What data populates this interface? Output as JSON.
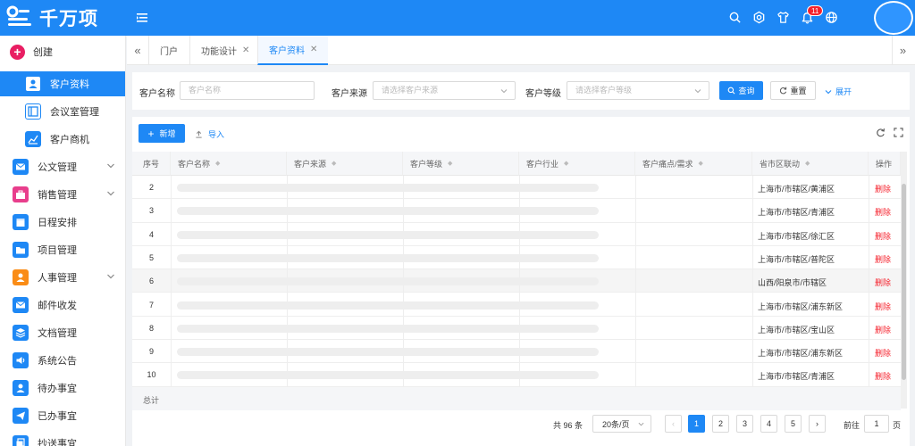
{
  "app": {
    "logo_text": "千万项",
    "notification_count": "11"
  },
  "colors": {
    "primary": "#1e88f5",
    "danger": "#f5222d",
    "create": "#e91e63"
  },
  "sidebar": {
    "create_label": "创建",
    "items": [
      {
        "label": "客户资料",
        "icon": "user-icon",
        "color": "#1e88f5",
        "active": true,
        "sub": true
      },
      {
        "label": "会议室管理",
        "icon": "layout-icon",
        "color": "#1e88f5",
        "sub": true
      },
      {
        "label": "客户商机",
        "icon": "chart-icon",
        "color": "#1e88f5",
        "sub": true
      },
      {
        "label": "公文管理",
        "icon": "mail-icon",
        "color": "#1e88f5",
        "expandable": true
      },
      {
        "label": "销售管理",
        "icon": "briefcase-icon",
        "color": "#e83e8c",
        "expandable": true
      },
      {
        "label": "日程安排",
        "icon": "calendar-icon",
        "color": "#1e88f5"
      },
      {
        "label": "项目管理",
        "icon": "folder-icon",
        "color": "#1e88f5"
      },
      {
        "label": "人事管理",
        "icon": "person-icon",
        "color": "#fa8c16",
        "expandable": true
      },
      {
        "label": "邮件收发",
        "icon": "mail-icon",
        "color": "#1e88f5"
      },
      {
        "label": "文档管理",
        "icon": "layers-icon",
        "color": "#1e88f5"
      },
      {
        "label": "系统公告",
        "icon": "speaker-icon",
        "color": "#1e88f5"
      },
      {
        "label": "待办事宜",
        "icon": "person-icon",
        "color": "#1e88f5"
      },
      {
        "label": "已办事宜",
        "icon": "send-icon",
        "color": "#1e88f5"
      },
      {
        "label": "抄送事宜",
        "icon": "copy-icon",
        "color": "#1e88f5"
      }
    ]
  },
  "tabs": [
    {
      "label": "门户",
      "closable": false
    },
    {
      "label": "功能设计",
      "closable": true
    },
    {
      "label": "客户资料",
      "closable": true,
      "active": true
    }
  ],
  "filters": {
    "name_label": "客户名称",
    "name_placeholder": "客户名称",
    "source_label": "客户来源",
    "source_placeholder": "请选择客户来源",
    "level_label": "客户等级",
    "level_placeholder": "请选择客户等级",
    "query_button": "查询",
    "reset_button": "重置",
    "expand_link": "展开"
  },
  "toolbar": {
    "add_button": "新增",
    "import_button": "导入"
  },
  "table": {
    "columns": [
      "序号",
      "客户名称",
      "客户来源",
      "客户等级",
      "客户行业",
      "客户痛点/需求",
      "省市区联动",
      "操作"
    ],
    "rows": [
      {
        "index": "2",
        "region": "上海市/市辖区/黄浦区",
        "action": "删除"
      },
      {
        "index": "3",
        "region": "上海市/市辖区/青浦区",
        "action": "删除"
      },
      {
        "index": "4",
        "region": "上海市/市辖区/徐汇区",
        "action": "删除"
      },
      {
        "index": "5",
        "region": "上海市/市辖区/普陀区",
        "action": "删除"
      },
      {
        "index": "6",
        "region": "山西/阳泉市/市辖区",
        "action": "删除",
        "highlighted": true
      },
      {
        "index": "7",
        "region": "上海市/市辖区/浦东新区",
        "action": "删除"
      },
      {
        "index": "8",
        "region": "上海市/市辖区/宝山区",
        "action": "删除"
      },
      {
        "index": "9",
        "region": "上海市/市辖区/浦东新区",
        "action": "删除"
      },
      {
        "index": "10",
        "region": "上海市/市辖区/青浦区",
        "action": "删除"
      }
    ],
    "summary_label": "总计"
  },
  "pagination": {
    "total_text": "共 96 条",
    "page_size": "20条/页",
    "pages": [
      "1",
      "2",
      "3",
      "4",
      "5"
    ],
    "current_page": "1",
    "goto_label": "前往",
    "goto_value": "1",
    "page_suffix": "页"
  }
}
